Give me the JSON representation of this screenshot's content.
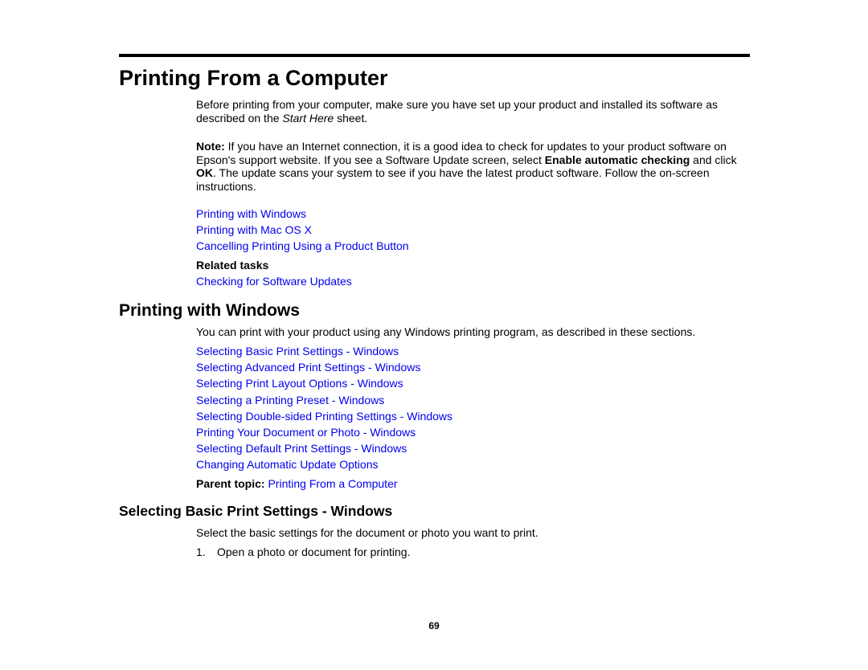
{
  "section1": {
    "title": "Printing From a Computer",
    "intro": {
      "before": "Before printing from your computer, make sure you have set up your product and installed its software as described on the ",
      "italic": "Start Here",
      "after": " sheet."
    },
    "note": {
      "label": "Note:",
      "text1": " If you have an Internet connection, it is a good idea to check for updates to your product software on Epson's support website. If you see a Software Update screen, select ",
      "bold1": "Enable automatic checking",
      "text2": " and click ",
      "bold2": "OK",
      "text3": ". The update scans your system to see if you have the latest product software. Follow the on-screen instructions."
    },
    "links": [
      "Printing with Windows",
      "Printing with Mac OS X",
      "Cancelling Printing Using a Product Button"
    ],
    "related_label": "Related tasks",
    "related_links": [
      "Checking for Software Updates"
    ]
  },
  "section2": {
    "title": "Printing with Windows",
    "intro": "You can print with your product using any Windows printing program, as described in these sections.",
    "links": [
      "Selecting Basic Print Settings - Windows",
      "Selecting Advanced Print Settings - Windows",
      "Selecting Print Layout Options - Windows",
      "Selecting a Printing Preset - Windows",
      "Selecting Double-sided Printing Settings - Windows",
      "Printing Your Document or Photo - Windows",
      "Selecting Default Print Settings - Windows",
      "Changing Automatic Update Options"
    ],
    "parent_label": "Parent topic:",
    "parent_link": "Printing From a Computer"
  },
  "section3": {
    "title": "Selecting Basic Print Settings - Windows",
    "intro": "Select the basic settings for the document or photo you want to print.",
    "steps": [
      {
        "num": "1.",
        "text": "Open a photo or document for printing."
      }
    ]
  },
  "page_number": "69",
  "colors": {
    "link": "#0000ee",
    "text": "#000000"
  }
}
